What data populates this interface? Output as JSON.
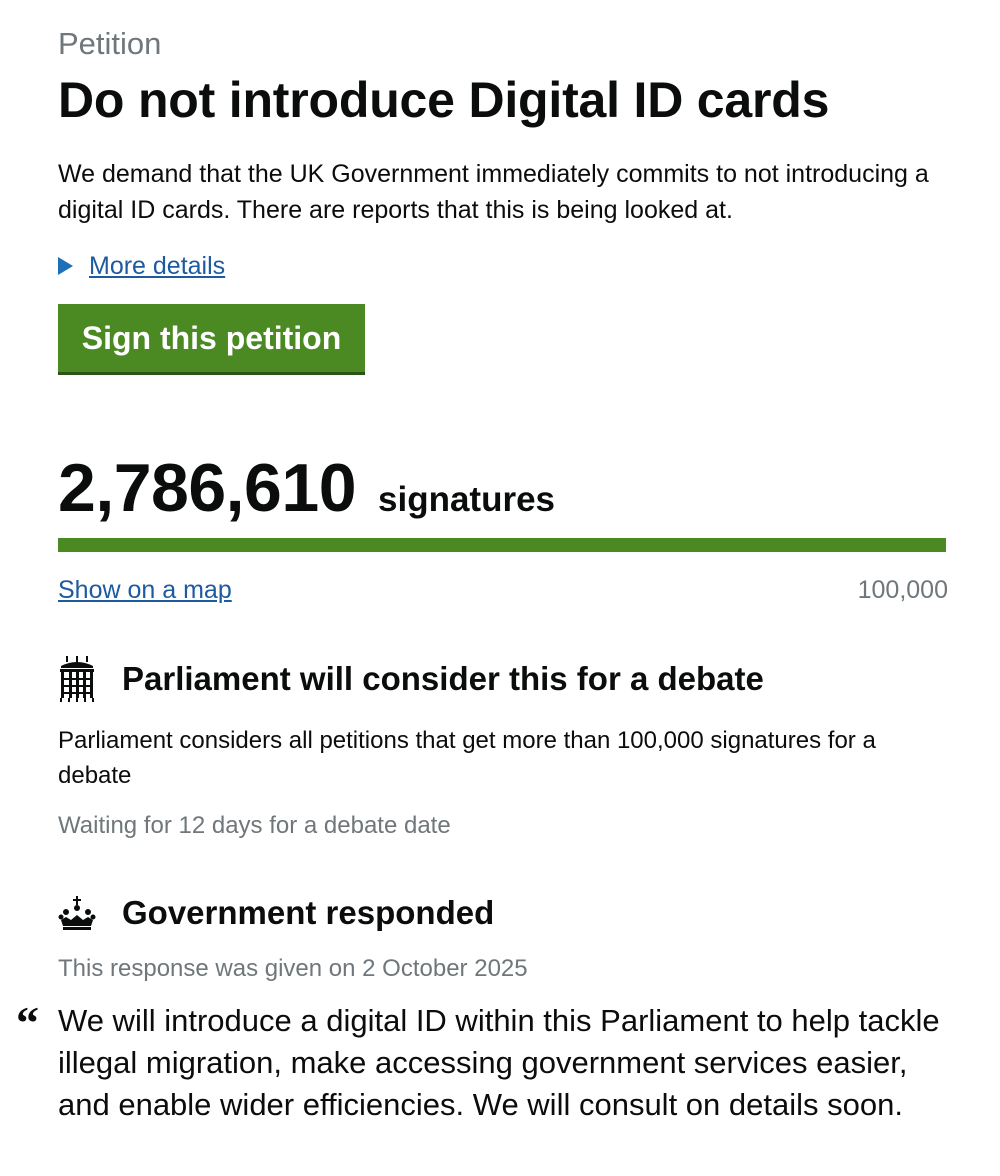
{
  "petition": {
    "caption": "Petition",
    "title": "Do not introduce Digital ID cards",
    "summary": "We demand that the UK Government immediately commits to not introducing a digital ID cards. There are reports that this is being looked at.",
    "more_details_label": "More details",
    "sign_button_label": "Sign this petition"
  },
  "signatures": {
    "count": "2,786,610",
    "label": "signatures",
    "progress_fraction": 1.0,
    "show_map_label": "Show on a map",
    "threshold": "100,000",
    "accent_color": "#4b8a23"
  },
  "debate": {
    "icon": "portcullis-icon",
    "heading": "Parliament will consider this for a debate",
    "text": "Parliament considers all petitions that get more than 100,000 signatures for a debate",
    "status": "Waiting for 12 days for a debate date"
  },
  "response": {
    "icon": "crown-icon",
    "heading": "Government responded",
    "date_text": "This response was given on 2 October 2025",
    "quote_mark": "“",
    "quote": "We will introduce a digital ID within this Parliament to help tackle illegal migration, make accessing government services easier, and enable wider efficiencies. We will consult on details soon."
  }
}
